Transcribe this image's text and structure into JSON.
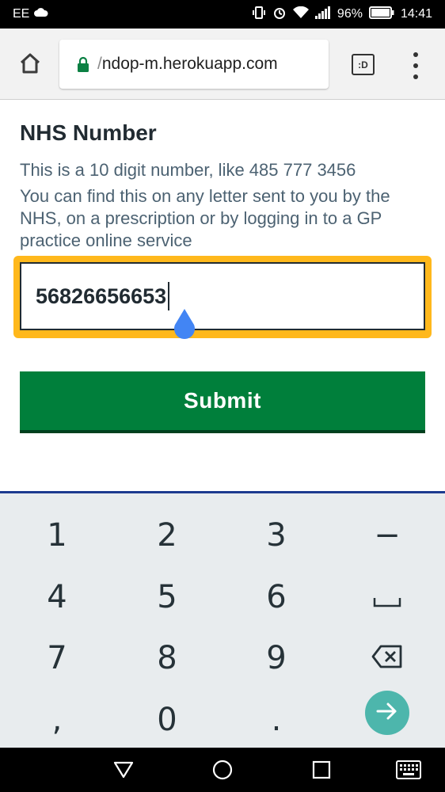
{
  "status_bar": {
    "carrier": "EE",
    "battery": "96%",
    "time": "14:41"
  },
  "browser": {
    "url_prefix": "/",
    "url": "ndop-m.herokuapp.com",
    "tab_icon_label": ":D"
  },
  "form": {
    "label": "NHS Number",
    "hint1": "This is a 10 digit number, like 485 777 3456",
    "hint2": "You can find this on any letter sent to you by the NHS, on a prescription or by logging in to a GP practice online service",
    "input_value": "56826656653",
    "submit_label": "Submit",
    "focus_color": "#ffb81c",
    "button_color": "#007f3b"
  },
  "keyboard": {
    "keys": [
      "1",
      "2",
      "3",
      "−",
      "4",
      "5",
      "6",
      "space",
      "7",
      "8",
      "9",
      "backspace",
      ",",
      "0",
      ".",
      "go"
    ],
    "labels": {
      "k1": "1",
      "k2": "2",
      "k3": "3",
      "kdash": "−",
      "k4": "4",
      "k5": "5",
      "k6": "6",
      "k7": "7",
      "k8": "8",
      "k9": "9",
      "kcomma": ",",
      "k0": "0",
      "kdot": "."
    }
  },
  "icons": [
    "wifi-icon",
    "signal-icon",
    "battery-icon",
    "alarm-icon",
    "vibrate-icon",
    "home-icon",
    "lock-icon",
    "menu-icon",
    "back-icon",
    "home-circle-icon",
    "recents-icon",
    "keyboard-icon"
  ]
}
